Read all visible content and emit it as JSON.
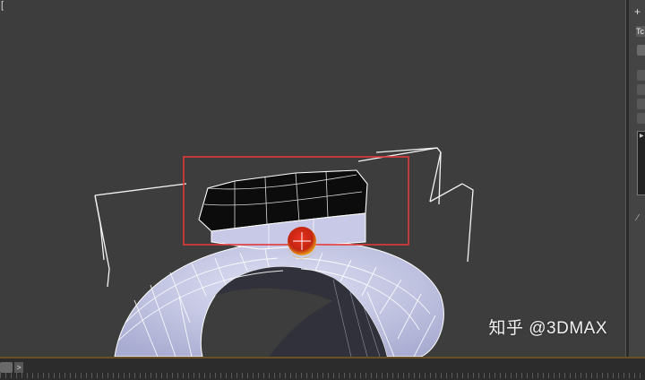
{
  "viewport": {
    "label": "[",
    "watermark": "知乎 @3DMAX",
    "selection_color": "#e03a3a",
    "mesh_color": "#b9bde0",
    "wire_color": "#ffffff",
    "background_color": "#3d3d3d"
  },
  "command_panel": {
    "tab_symbol": "+",
    "label_text": "Tc"
  },
  "timeline": {
    "next_symbol": ">"
  }
}
